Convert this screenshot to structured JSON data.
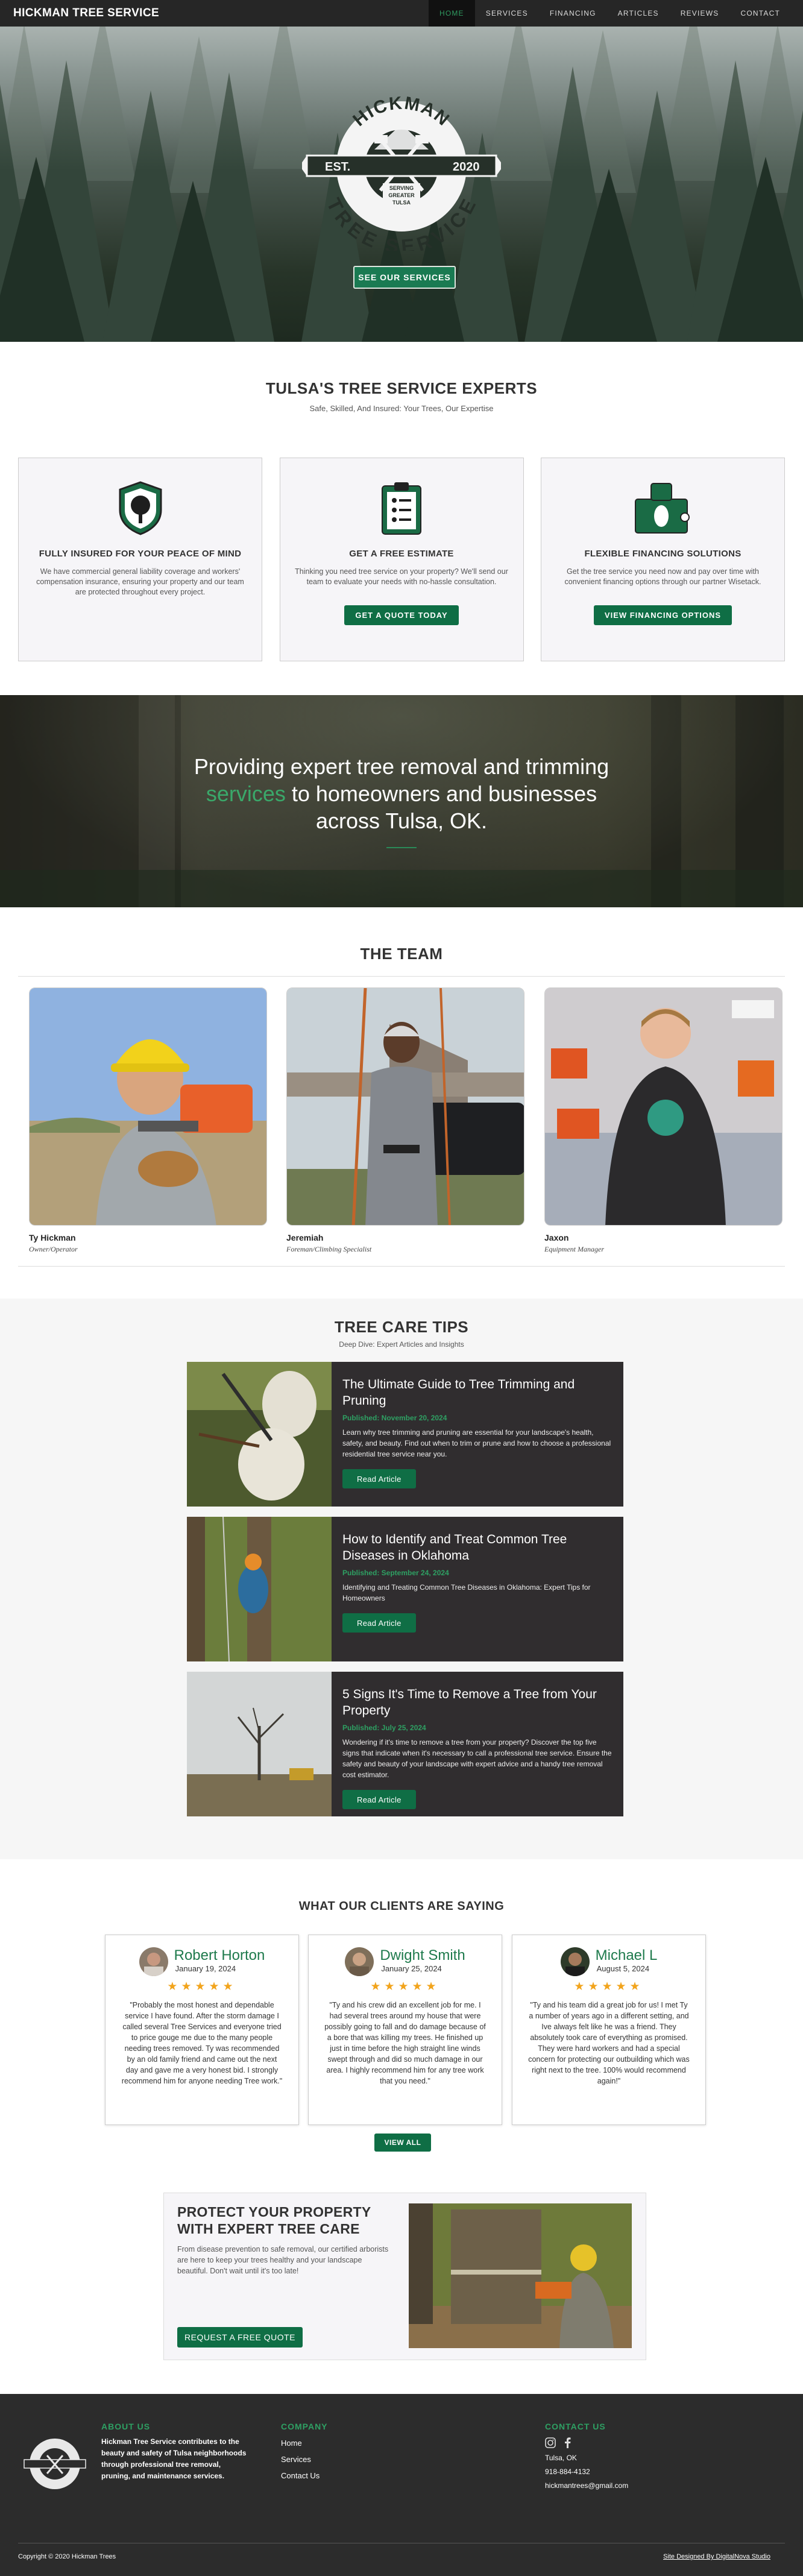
{
  "nav": {
    "brand": "HICKMAN TREE SERVICE",
    "items": [
      {
        "label": "HOME",
        "active": true
      },
      {
        "label": "SERVICES"
      },
      {
        "label": "FINANCING"
      },
      {
        "label": "ARTICLES"
      },
      {
        "label": "REVIEWS"
      },
      {
        "label": "CONTACT"
      }
    ]
  },
  "hero": {
    "logo": {
      "top": "HICKMAN",
      "bottom": "TREE SERVICE",
      "left": "EST.",
      "right": "2020",
      "ribbon": [
        "SERVING",
        "GREATER",
        "TULSA"
      ]
    },
    "button": "SEE OUR SERVICES"
  },
  "experts": {
    "title": "TULSA'S TREE SERVICE EXPERTS",
    "subtitle": "Safe, Skilled, And Insured: Your Trees, Our Expertise",
    "cards": [
      {
        "icon": "shield-tree-icon",
        "title": "FULLY INSURED FOR YOUR PEACE OF MIND",
        "text": "We have commercial general liability coverage and workers' compensation insurance, ensuring your property and our team are protected throughout every project.",
        "button": null
      },
      {
        "icon": "clipboard-icon",
        "title": "GET A FREE ESTIMATE",
        "text": "Thinking you need tree service on your property? We'll send our team to evaluate your needs with no-hassle consultation.",
        "button": "GET A QUOTE TODAY"
      },
      {
        "icon": "money-icon",
        "title": "FLEXIBLE FINANCING SOLUTIONS",
        "text": "Get the tree service you need now and pay over time with convenient financing options through our partner Wisetack.",
        "button": "VIEW FINANCING OPTIONS"
      }
    ]
  },
  "banner": {
    "part1": "Providing expert tree removal and trimming",
    "highlight": "services",
    "part2": "to homeowners and businesses",
    "part3": "across Tulsa, OK."
  },
  "team": {
    "title": "THE TEAM",
    "members": [
      {
        "name": "Ty Hickman",
        "role": "Owner/Operator"
      },
      {
        "name": "Jeremiah",
        "role": "Foreman/Climbing Specialist"
      },
      {
        "name": "Jaxon",
        "role": "Equipment Manager"
      }
    ]
  },
  "tips": {
    "title": "TREE CARE TIPS",
    "subtitle": "Deep Dive: Expert Articles and Insights",
    "articles": [
      {
        "title": "The Ultimate Guide to Tree Trimming and Pruning",
        "published": "Published: November 20, 2024",
        "excerpt": "Learn why tree trimming and pruning are essential for your landscape's health, safety, and beauty. Find out when to trim or prune and how to choose a professional residential tree service near you.",
        "button": "Read Article"
      },
      {
        "title": "How to Identify and Treat Common Tree Diseases in Oklahoma",
        "published": "Published: September 24, 2024",
        "excerpt": "Identifying and Treating Common Tree Diseases in Oklahoma: Expert Tips for Homeowners",
        "button": "Read Article"
      },
      {
        "title": "5 Signs It's Time to Remove a Tree from Your Property",
        "published": "Published: July 25, 2024",
        "excerpt": "Wondering if it's time to remove a tree from your property? Discover the top five signs that indicate when it's necessary to call a professional tree service. Ensure the safety and beauty of your landscape with expert advice and a handy tree removal cost estimator.",
        "button": "Read Article"
      }
    ]
  },
  "reviews": {
    "title": "WHAT OUR CLIENTS ARE SAYING",
    "items": [
      {
        "name": "Robert Horton",
        "date": "January 19, 2024",
        "stars": "★★★★★",
        "rating": 5,
        "text": "\"Probably the most honest and dependable service I have found. After the storm damage I called several Tree Services and everyone tried to price gouge me due to the many people needing trees removed. Ty was recommended by an old family friend and came out the next day and gave me a very honest bid. I strongly recommend him for anyone needing Tree work.\""
      },
      {
        "name": "Dwight Smith",
        "date": "January 25, 2024",
        "stars": "★★★★★",
        "rating": 5,
        "text": "\"Ty and his crew did an excellent job for me. I had several trees around my house that were possibly going to fall and do damage because of a bore that was killing my trees. He finished up just in time before the high straight line winds swept through and did so much damage in our area. I highly recommend him for any tree work that you need.\""
      },
      {
        "name": "Michael L",
        "date": "August 5, 2024",
        "stars": "★★★★★",
        "rating": 5,
        "text": "\"Ty and his team did a great job for us! I met Ty a number of years ago in a different setting, and Ive always felt like he was a friend. They absolutely took care of everything as promised. They were hard workers and had a special concern for protecting our outbuilding which was right next to the tree. 100% would recommend again!\""
      }
    ],
    "view_all": "VIEW ALL"
  },
  "protect": {
    "title_line1": "PROTECT YOUR PROPERTY",
    "title_line2": "WITH EXPERT TREE CARE",
    "text": "From disease prevention to safe removal, our certified arborists are here to keep your trees healthy and your landscape beautiful. Don't wait until it's too late!",
    "button": "REQUEST A FREE QUOTE"
  },
  "footer": {
    "about_title": "ABOUT US",
    "about_text": "Hickman Tree Service contributes to the beauty and safety of Tulsa neighborhoods through professional tree removal, pruning, and maintenance services.",
    "company_title": "COMPANY",
    "company_links": [
      "Home",
      "Services",
      "Contact Us"
    ],
    "contact_title": "CONTACT US",
    "city": "Tulsa, OK",
    "phone": "918-884-4132",
    "email": "hickmantrees@gmail.com",
    "copyright": "Copyright © 2020 Hickman Trees",
    "credit": "Site Designed By DigitalNova Studio"
  },
  "colors": {
    "brand_green": "#0f6e45",
    "accent_green": "#2ea063",
    "dark": "#262626",
    "star": "#f2a41c"
  }
}
